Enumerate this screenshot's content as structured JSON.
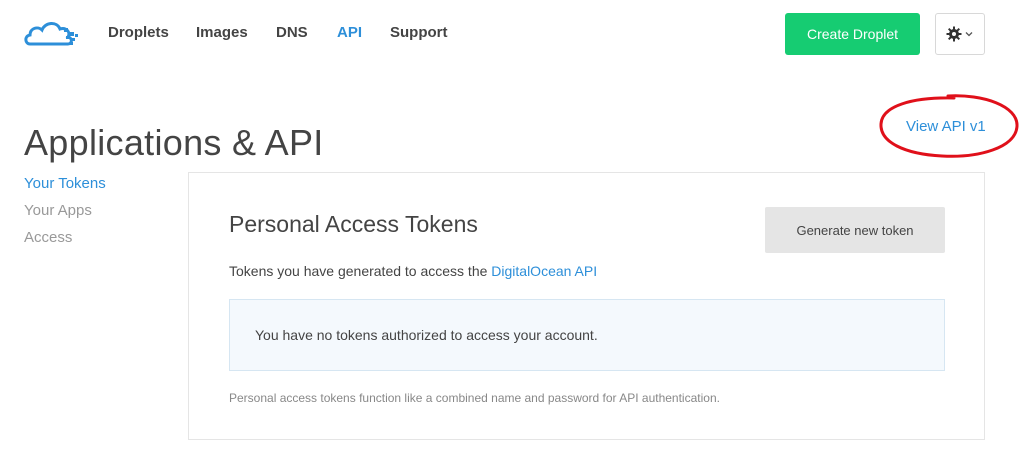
{
  "nav": {
    "items": [
      {
        "label": "Droplets",
        "active": false
      },
      {
        "label": "Images",
        "active": false
      },
      {
        "label": "DNS",
        "active": false
      },
      {
        "label": "API",
        "active": true
      },
      {
        "label": "Support",
        "active": false
      }
    ],
    "create_label": "Create Droplet",
    "settings_icon": "gear-icon",
    "dropdown_icon": "chevron-down-icon"
  },
  "page": {
    "title": "Applications & API",
    "view_api_link": "View API v1"
  },
  "sidebar": {
    "items": [
      {
        "label": "Your Tokens",
        "active": true
      },
      {
        "label": "Your Apps",
        "active": false
      },
      {
        "label": "Access",
        "active": false
      }
    ]
  },
  "panel": {
    "title": "Personal Access Tokens",
    "generate_label": "Generate new token",
    "subtitle_prefix": "Tokens you have generated to access the ",
    "subtitle_link": "DigitalOcean API",
    "empty_message": "You have no tokens authorized to access your account.",
    "footnote": "Personal access tokens function like a combined name and password for API authentication."
  },
  "colors": {
    "accent": "#2d8fd9",
    "create_button": "#16cc72",
    "annotation": "#e0101a"
  }
}
